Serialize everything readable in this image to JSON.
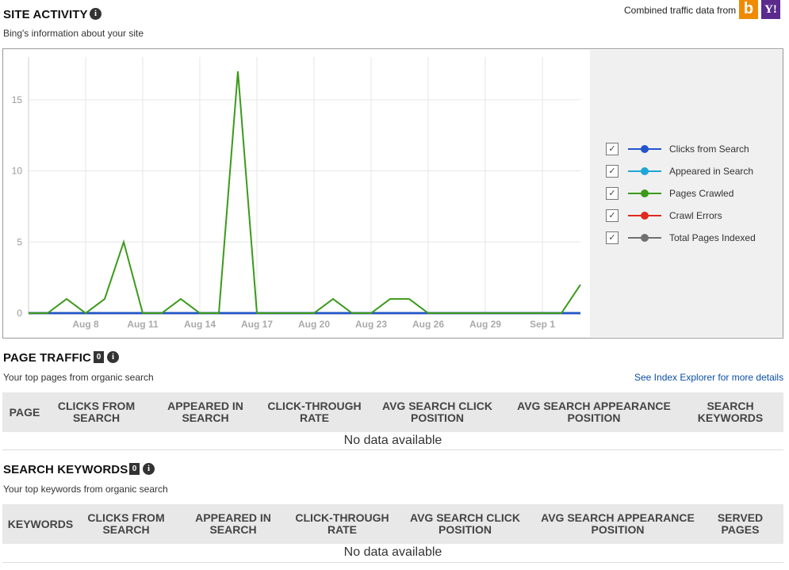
{
  "site_activity": {
    "title": "SITE ACTIVITY",
    "subtitle": "Bing's information about your site",
    "combined_label": "Combined traffic data from",
    "bing_logo": "b",
    "yahoo_logo": "Y!"
  },
  "chart_data": {
    "type": "line",
    "x": [
      "Aug 5",
      "Aug 6",
      "Aug 7",
      "Aug 8",
      "Aug 9",
      "Aug 10",
      "Aug 11",
      "Aug 12",
      "Aug 13",
      "Aug 14",
      "Aug 15",
      "Aug 16",
      "Aug 17",
      "Aug 18",
      "Aug 19",
      "Aug 20",
      "Aug 21",
      "Aug 22",
      "Aug 23",
      "Aug 24",
      "Aug 25",
      "Aug 26",
      "Aug 27",
      "Aug 28",
      "Aug 29",
      "Aug 30",
      "Aug 31",
      "Sep 1",
      "Sep 2",
      "Sep 3"
    ],
    "x_tick_labels": [
      "Aug 8",
      "Aug 11",
      "Aug 14",
      "Aug 17",
      "Aug 20",
      "Aug 23",
      "Aug 26",
      "Aug 29",
      "Sep 1"
    ],
    "y_ticks": [
      0,
      5,
      10,
      15
    ],
    "ylim": [
      0,
      18
    ],
    "series": [
      {
        "name": "Clicks from Search",
        "color": "#2255cc",
        "values": [
          0,
          0,
          0,
          0,
          0,
          0,
          0,
          0,
          0,
          0,
          0,
          0,
          0,
          0,
          0,
          0,
          0,
          0,
          0,
          0,
          0,
          0,
          0,
          0,
          0,
          0,
          0,
          0,
          0,
          0
        ]
      },
      {
        "name": "Appeared in Search",
        "color": "#1ea6d6",
        "values": [
          0,
          0,
          0,
          0,
          0,
          0,
          0,
          0,
          0,
          0,
          0,
          0,
          0,
          0,
          0,
          0,
          0,
          0,
          0,
          0,
          0,
          0,
          0,
          0,
          0,
          0,
          0,
          0,
          0,
          0
        ]
      },
      {
        "name": "Pages Crawled",
        "color": "#3a9a1a",
        "values": [
          0,
          0,
          1,
          0,
          1,
          5,
          0,
          0,
          1,
          0,
          0,
          17,
          0,
          0,
          0,
          0,
          1,
          0,
          0,
          1,
          1,
          0,
          0,
          0,
          0,
          0,
          0,
          0,
          0,
          2
        ]
      },
      {
        "name": "Crawl Errors",
        "color": "#e0291f",
        "values": [
          0,
          0,
          0,
          0,
          0,
          0,
          0,
          0,
          0,
          0,
          0,
          0,
          0,
          0,
          0,
          0,
          0,
          0,
          0,
          0,
          0,
          0,
          0,
          0,
          0,
          0,
          0,
          0,
          0,
          0
        ]
      },
      {
        "name": "Total Pages Indexed",
        "color": "#707070",
        "values": [
          0,
          0,
          0,
          0,
          0,
          0,
          0,
          0,
          0,
          0,
          0,
          0,
          0,
          0,
          0,
          0,
          0,
          0,
          0,
          0,
          0,
          0,
          0,
          0,
          0,
          0,
          0,
          0,
          0,
          0
        ]
      }
    ],
    "grid": true,
    "legend": "right"
  },
  "legend": [
    {
      "label": "Clicks from Search",
      "color": "#2255cc",
      "checked": "✓"
    },
    {
      "label": "Appeared in Search",
      "color": "#1ea6d6",
      "checked": "✓"
    },
    {
      "label": "Pages Crawled",
      "color": "#3a9a1a",
      "checked": "✓"
    },
    {
      "label": "Crawl Errors",
      "color": "#e0291f",
      "checked": "✓"
    },
    {
      "label": "Total Pages Indexed",
      "color": "#707070",
      "checked": "✓"
    }
  ],
  "page_traffic": {
    "title": "PAGE TRAFFIC",
    "count": "0",
    "subtitle": "Your top pages from organic search",
    "link": "See Index Explorer for more details",
    "columns": [
      "PAGE",
      "CLICKS FROM SEARCH",
      "APPEARED IN SEARCH",
      "CLICK-THROUGH RATE",
      "AVG SEARCH CLICK POSITION",
      "AVG SEARCH APPEARANCE POSITION",
      "SEARCH KEYWORDS"
    ],
    "empty": "No data available"
  },
  "search_keywords": {
    "title": "SEARCH KEYWORDS",
    "count": "0",
    "subtitle": "Your top keywords from organic search",
    "columns": [
      "KEYWORDS",
      "CLICKS FROM SEARCH",
      "APPEARED IN SEARCH",
      "CLICK-THROUGH RATE",
      "AVG SEARCH CLICK POSITION",
      "AVG SEARCH APPEARANCE POSITION",
      "SERVED PAGES"
    ],
    "empty": "No data available"
  },
  "info_icon": "i"
}
